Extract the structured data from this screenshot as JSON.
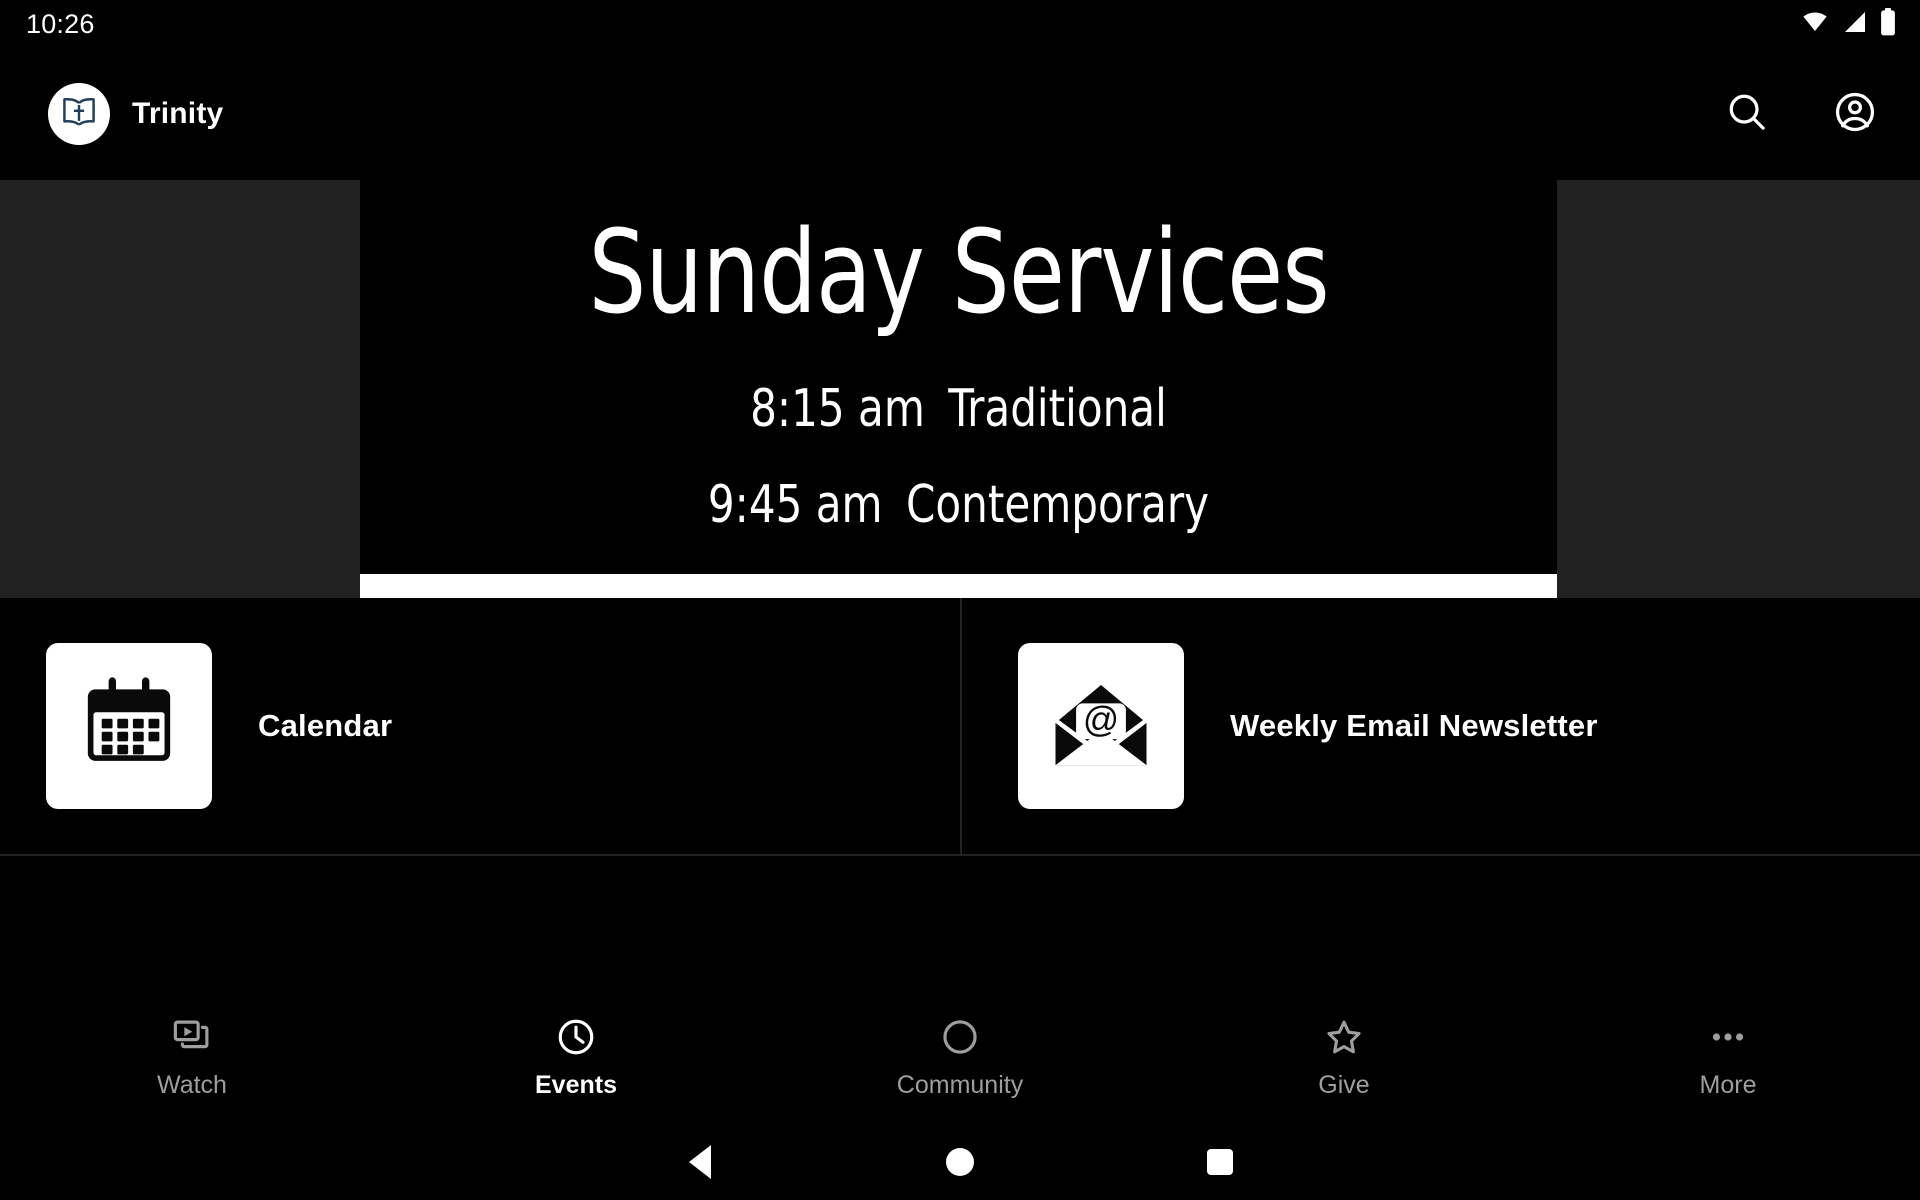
{
  "status_bar": {
    "clock": "10:26",
    "icons": [
      "wifi-icon",
      "cellular-signal-icon",
      "battery-icon"
    ]
  },
  "app_bar": {
    "logo_icon": "open-bible-cross-icon",
    "logo_color": "#1f3f5c",
    "app_name": "Trinity",
    "actions": [
      {
        "name": "search-icon",
        "label": "Search"
      },
      {
        "name": "account-circle-icon",
        "label": "Account"
      }
    ]
  },
  "hero": {
    "title": "Sunday Services",
    "services": [
      {
        "time": "8:15 am",
        "name": "Traditional"
      },
      {
        "time": "9:45 am",
        "name": "Contemporary"
      }
    ],
    "background_color": "#000000",
    "surround_color": "#212121",
    "accent_bar_color": "#ffffff"
  },
  "tiles": [
    {
      "icon": "calendar-icon",
      "label": "Calendar"
    },
    {
      "icon": "email-at-envelope-icon",
      "label": "Weekly Email Newsletter"
    }
  ],
  "bottom_nav": {
    "active_index": 1,
    "items": [
      {
        "icon": "video-library-icon",
        "label": "Watch"
      },
      {
        "icon": "clock-icon",
        "label": "Events"
      },
      {
        "icon": "circle-outline-icon",
        "label": "Community"
      },
      {
        "icon": "star-outline-icon",
        "label": "Give"
      },
      {
        "icon": "more-horizontal-icon",
        "label": "More"
      }
    ],
    "inactive_color": "#9e9e9e",
    "active_color": "#ffffff"
  },
  "system_nav": {
    "buttons": [
      {
        "name": "back-button",
        "icon": "triangle-back-icon"
      },
      {
        "name": "home-button",
        "icon": "circle-home-icon"
      },
      {
        "name": "recents-button",
        "icon": "square-recents-icon"
      }
    ]
  }
}
